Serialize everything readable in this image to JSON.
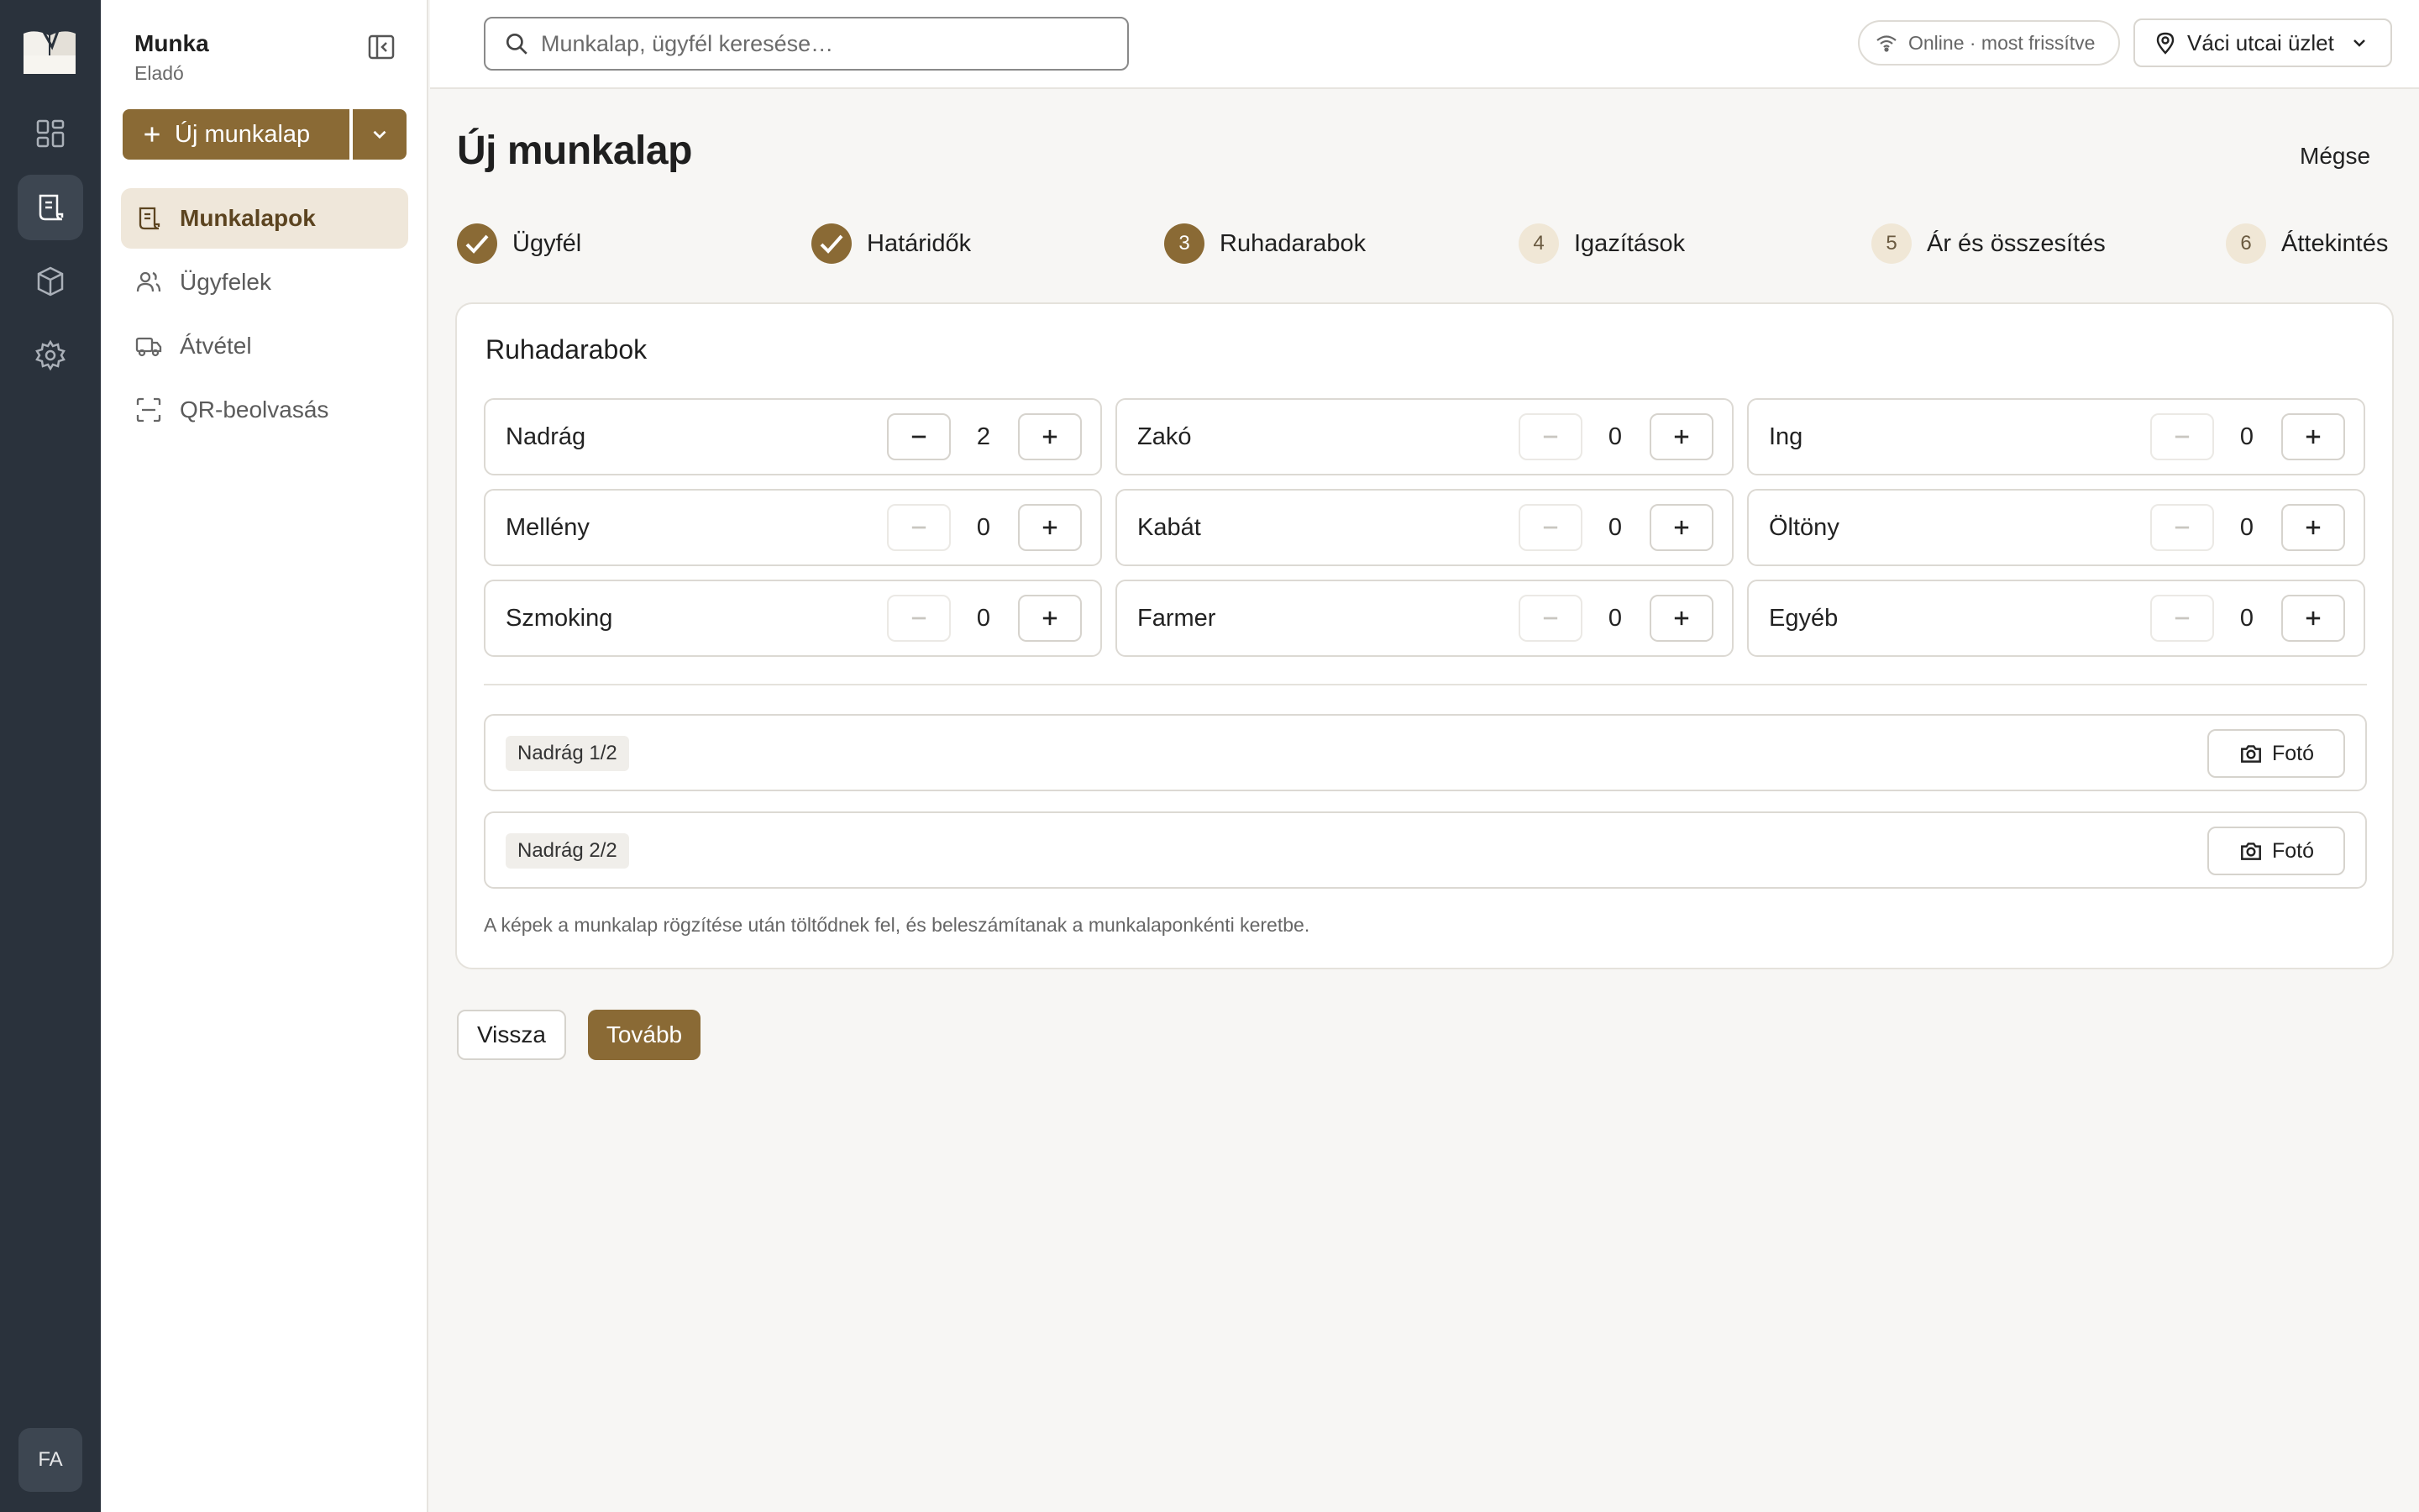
{
  "rail": {
    "avatar_initials": "FA",
    "items": [
      {
        "icon": "dashboard-grid-icon"
      },
      {
        "icon": "worksheet-icon",
        "active": true
      },
      {
        "icon": "box-icon"
      },
      {
        "icon": "gear-icon"
      }
    ]
  },
  "sidebar": {
    "title": "Munka",
    "subtitle": "Eladó",
    "new_button_label": "Új munkalap",
    "nav": [
      {
        "label": "Munkalapok",
        "icon": "worksheet-icon",
        "active": true
      },
      {
        "label": "Ügyfelek",
        "icon": "users-icon",
        "active": false
      },
      {
        "label": "Átvétel",
        "icon": "truck-icon",
        "active": false
      },
      {
        "label": "QR-beolvasás",
        "icon": "qr-scan-icon",
        "active": false
      }
    ]
  },
  "topbar": {
    "search_placeholder": "Munkalap, ügyfél keresése…",
    "status": "Online · most frissítve",
    "store": "Váci utcai üzlet"
  },
  "page": {
    "title": "Új munkalap",
    "cancel": "Mégse"
  },
  "steps": [
    {
      "number": "1",
      "label": "Ügyfél",
      "state": "done"
    },
    {
      "number": "2",
      "label": "Határidők",
      "state": "done"
    },
    {
      "number": "3",
      "label": "Ruhadarabok",
      "state": "current"
    },
    {
      "number": "4",
      "label": "Igazítások",
      "state": "todo"
    },
    {
      "number": "5",
      "label": "Ár és összesítés",
      "state": "todo"
    },
    {
      "number": "6",
      "label": "Áttekintés",
      "state": "todo"
    }
  ],
  "garments_section": {
    "title": "Ruhadarabok",
    "items": [
      {
        "name": "Nadrág",
        "count": "2"
      },
      {
        "name": "Zakó",
        "count": "0"
      },
      {
        "name": "Ing",
        "count": "0"
      },
      {
        "name": "Mellény",
        "count": "0"
      },
      {
        "name": "Kabát",
        "count": "0"
      },
      {
        "name": "Öltöny",
        "count": "0"
      },
      {
        "name": "Szmoking",
        "count": "0"
      },
      {
        "name": "Farmer",
        "count": "0"
      },
      {
        "name": "Egyéb",
        "count": "0"
      }
    ],
    "photo_rows": [
      {
        "tag": "Nadrág 1/2",
        "button": "Fotó"
      },
      {
        "tag": "Nadrág 2/2",
        "button": "Fotó"
      }
    ],
    "note": "A képek a munkalap rögzítése után töltődnek fel, és beleszámítanak a munkalaponkénti keretbe."
  },
  "actions": {
    "back": "Vissza",
    "next": "Tovább"
  },
  "colors": {
    "accent": "#8a6a35",
    "rail_bg": "#2a323c",
    "active_nav_bg": "#efe7da"
  }
}
